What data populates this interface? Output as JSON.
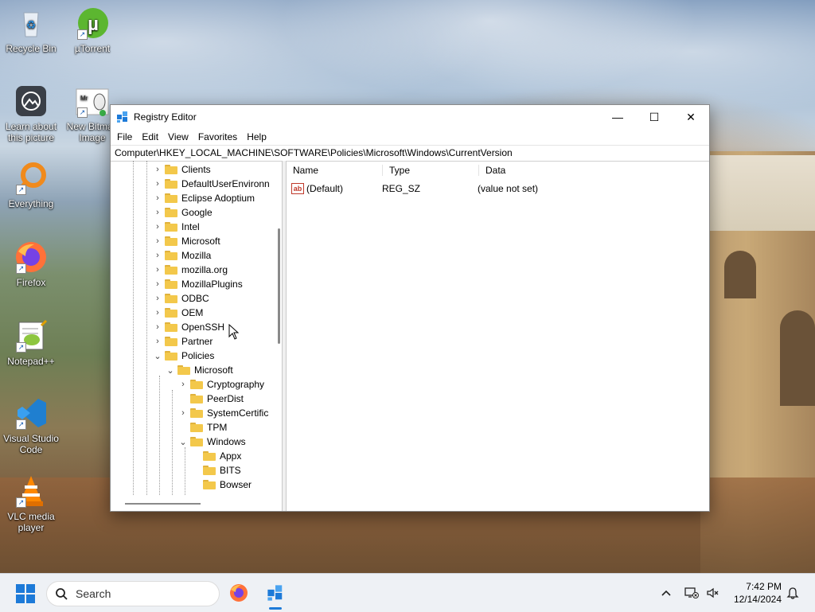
{
  "desktop": {
    "icons": [
      {
        "label": "Recycle Bin",
        "icon": "recycle-bin-icon"
      },
      {
        "label": "µTorrent",
        "icon": "utorrent-icon"
      },
      {
        "label": "Learn about this picture",
        "icon": "learn-picture-icon"
      },
      {
        "label": "New Bitmap Image",
        "icon": "bitmap-image-icon"
      },
      {
        "label": "Everything",
        "icon": "everything-search-icon"
      },
      {
        "label": "Firefox",
        "icon": "firefox-icon"
      },
      {
        "label": "Notepad++",
        "icon": "notepadpp-icon"
      },
      {
        "label": "Visual Studio Code",
        "icon": "vscode-icon"
      },
      {
        "label": "VLC media player",
        "icon": "vlc-icon"
      }
    ]
  },
  "window": {
    "title": "Registry Editor",
    "buttons": {
      "minimize": "—",
      "maximize": "☐",
      "close": "✕"
    },
    "menu": [
      "File",
      "Edit",
      "View",
      "Favorites",
      "Help"
    ],
    "address": "Computer\\HKEY_LOCAL_MACHINE\\SOFTWARE\\Policies\\Microsoft\\Windows\\CurrentVersion",
    "tree": [
      {
        "label": "Clients",
        "expander": "›"
      },
      {
        "label": "DefaultUserEnvironn",
        "expander": "›"
      },
      {
        "label": "Eclipse Adoptium",
        "expander": "›"
      },
      {
        "label": "Google",
        "expander": "›"
      },
      {
        "label": "Intel",
        "expander": "›"
      },
      {
        "label": "Microsoft",
        "expander": "›"
      },
      {
        "label": "Mozilla",
        "expander": "›"
      },
      {
        "label": "mozilla.org",
        "expander": "›"
      },
      {
        "label": "MozillaPlugins",
        "expander": "›"
      },
      {
        "label": "ODBC",
        "expander": "›"
      },
      {
        "label": "OEM",
        "expander": "›"
      },
      {
        "label": "OpenSSH",
        "expander": "›"
      },
      {
        "label": "Partner",
        "expander": "›"
      },
      {
        "label": "Policies",
        "expander": "⌄"
      },
      {
        "label": "Microsoft",
        "expander": "⌄"
      },
      {
        "label": "Cryptography",
        "expander": "›"
      },
      {
        "label": "PeerDist",
        "expander": ""
      },
      {
        "label": "SystemCertific",
        "expander": "›"
      },
      {
        "label": "TPM",
        "expander": ""
      },
      {
        "label": "Windows",
        "expander": "⌄"
      },
      {
        "label": "Appx",
        "expander": ""
      },
      {
        "label": "BITS",
        "expander": ""
      },
      {
        "label": "Bowser",
        "expander": ""
      }
    ],
    "list": {
      "headers": {
        "name": "Name",
        "type": "Type",
        "data": "Data"
      },
      "rows": [
        {
          "name": "(Default)",
          "type": "REG_SZ",
          "data": "(value not set)",
          "icon": "ab"
        }
      ]
    }
  },
  "taskbar": {
    "search_placeholder": "Search",
    "apps": [
      "firefox-icon",
      "registry-editor-icon"
    ],
    "time": "7:42 PM",
    "date": "12/14/2024"
  },
  "colors": {
    "accent": "#1d7ad8",
    "folder": "#f3c84b"
  }
}
